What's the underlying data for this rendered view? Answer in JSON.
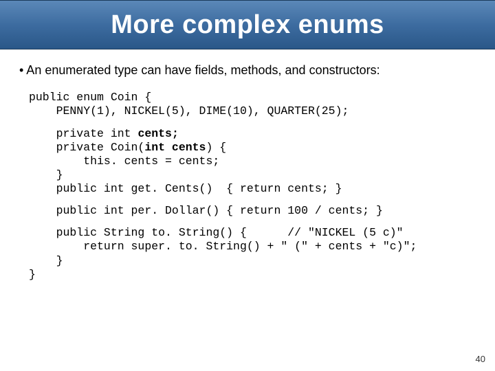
{
  "title": "More complex enums",
  "bullet": "• An enumerated type can have fields, methods, and constructors:",
  "code": {
    "l1": "public enum Coin {",
    "l2": "    PENNY(1), NICKEL(5), DIME(10), QUARTER(25);",
    "l3a": "    private int ",
    "l3b": "cents;",
    "l4a": "    private Coin(",
    "l4b": "int cents",
    "l4c": ") {",
    "l5": "        this. cents = cents;",
    "l6": "    }",
    "l7": "    public int get. Cents()  { return cents; }",
    "l8": "    public int per. Dollar() { return 100 / cents; }",
    "l9": "    public String to. String() {      // \"NICKEL (5 c)\"",
    "l10": "        return super. to. String() + \" (\" + cents + \"c)\";",
    "l11": "    }",
    "l12": "}"
  },
  "page_number": "40"
}
